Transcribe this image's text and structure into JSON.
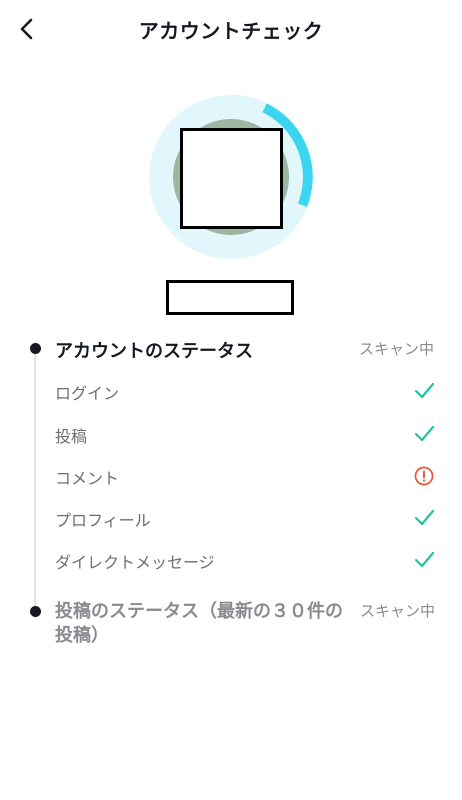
{
  "header": {
    "title": "アカウントチェック"
  },
  "sections": [
    {
      "title": "アカウントのステータス",
      "status": "スキャン中",
      "items": [
        {
          "label": "ログイン",
          "result": "ok"
        },
        {
          "label": "投稿",
          "result": "ok"
        },
        {
          "label": "コメント",
          "result": "warning"
        },
        {
          "label": "プロフィール",
          "result": "ok"
        },
        {
          "label": "ダイレクトメッセージ",
          "result": "ok"
        }
      ]
    },
    {
      "title": "投稿のステータス（最新の３０件の投稿）",
      "status": "スキャン中"
    }
  ],
  "colors": {
    "ok": "#20c3a4",
    "warning": "#e8553b",
    "ring_fill": "#31d3ee",
    "ring_track": "#e2f7fb"
  },
  "icons": {
    "back": "chevron-left-icon",
    "ok": "checkmark-icon",
    "warning": "alert-circle-icon"
  }
}
